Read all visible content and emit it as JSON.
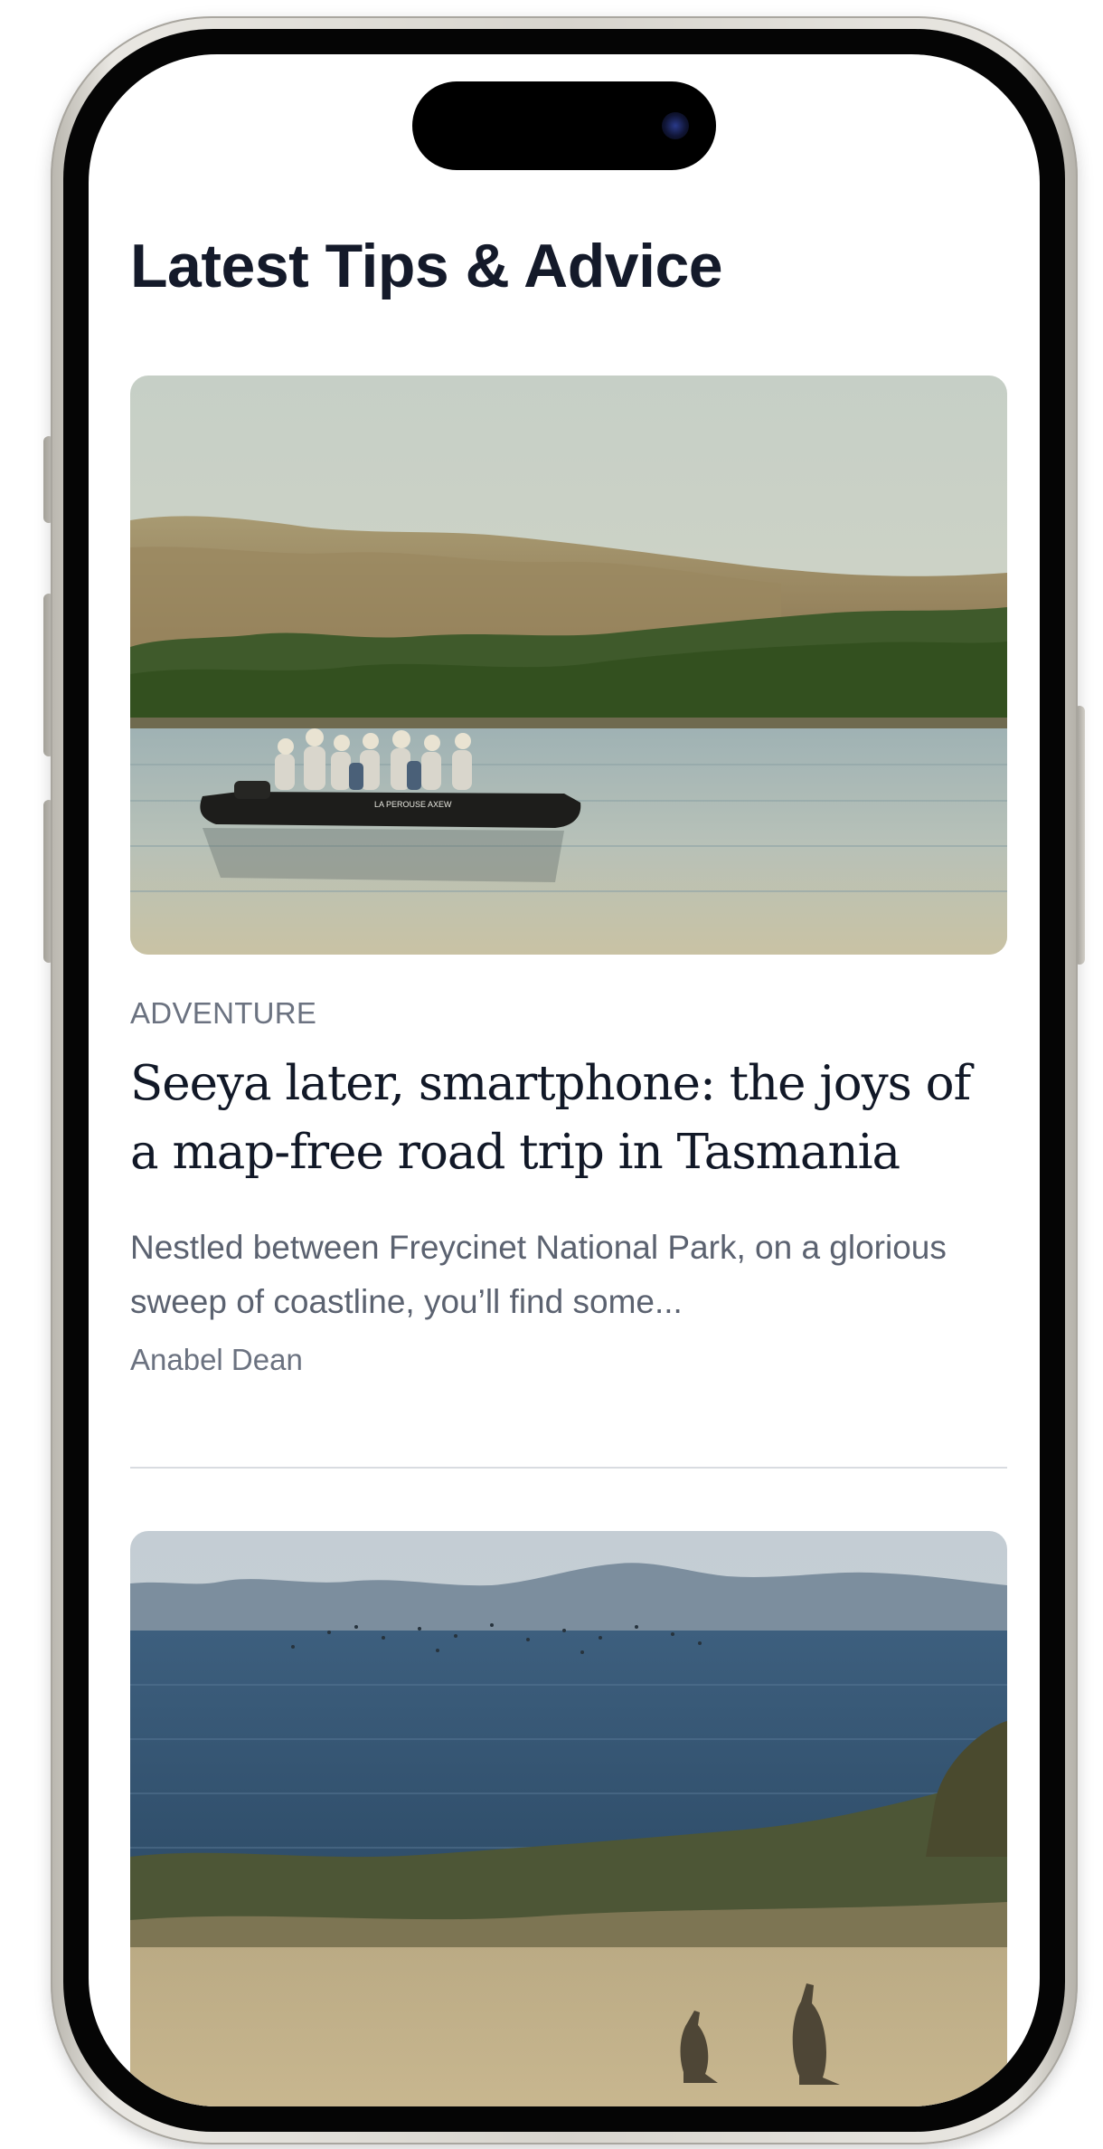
{
  "page": {
    "title": "Latest Tips & Advice"
  },
  "articles": [
    {
      "category": "ADVENTURE",
      "headline": "Seeya later, smartphone: the joys of a map-free road trip in Tasmania",
      "excerpt": "Nestled between Freycinet National Park, on a glorious sweep of coastline, you’ll find some...",
      "author": "Anabel Dean",
      "image": {
        "subject": "tour-boat-on-river",
        "boat_text": "LA PEROUSE AXEW"
      }
    },
    {
      "image": {
        "subject": "kangaroos-by-the-sea"
      }
    }
  ],
  "colors": {
    "title": "#141a2a",
    "headline": "#111827",
    "meta": "#6b7280",
    "divider": "#d9dce1"
  }
}
